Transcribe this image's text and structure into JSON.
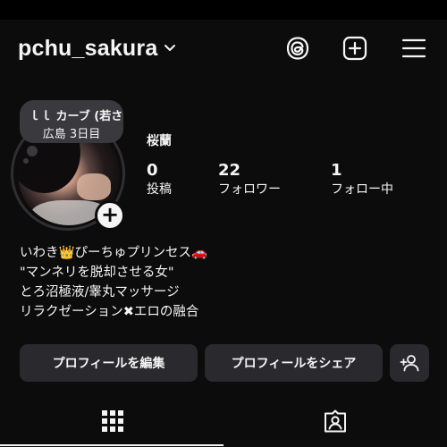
{
  "header": {
    "username": "pchu_sakura"
  },
  "note": {
    "line1": "ｌｌ カーブ (若さ",
    "line2": "広島 3日目"
  },
  "profile": {
    "display_name": "桜蘭"
  },
  "stats": [
    {
      "number": "0",
      "label": "投稿"
    },
    {
      "number": "22",
      "label": "フォロワー"
    },
    {
      "number": "1",
      "label": "フォロー中"
    }
  ],
  "bio": [
    "いわき👑ぴーちゅプリンセス🚗",
    "\"マンネリを脱却させる女\"",
    "とろ沼極液/睾丸マッサージ",
    "リラクゼーション✖エロの融合"
  ],
  "buttons": {
    "edit_profile": "プロフィールを編集",
    "share_profile": "プロフィールをシェア"
  },
  "colors": {
    "background": "#0c0c0c",
    "text": "#f5f5f5",
    "button": "#2a2a2e",
    "note_bubble": "#3a3a3e"
  },
  "icons": {
    "header": [
      "threads-icon",
      "new-post-icon",
      "menu-icon"
    ],
    "tabs": [
      "grid-icon",
      "tagged-icon"
    ],
    "add_person": "add-person-icon"
  }
}
